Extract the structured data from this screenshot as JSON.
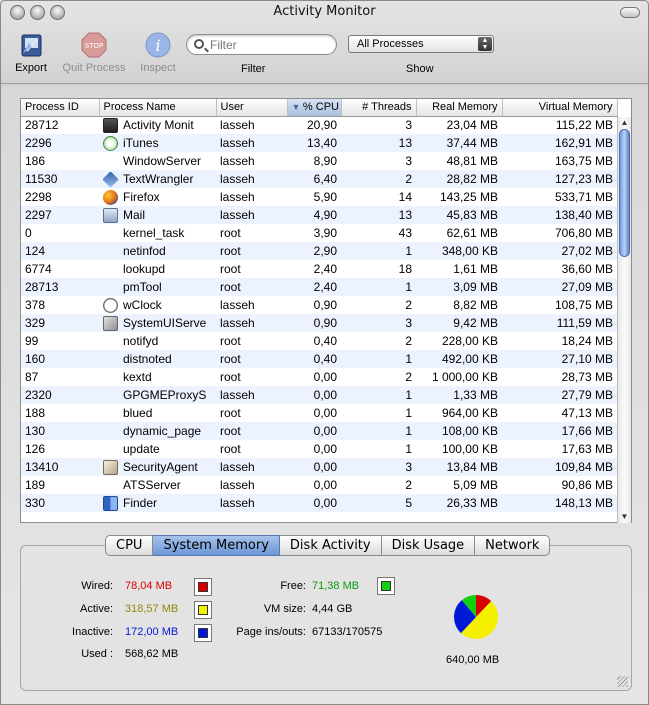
{
  "window": {
    "title": "Activity Monitor"
  },
  "toolbar": {
    "export_label": "Export",
    "quit_label": "Quit Process",
    "inspect_label": "Inspect",
    "filter_placeholder": "Filter",
    "filter_label": "Filter",
    "show_label": "Show",
    "show_value": "All Processes"
  },
  "table": {
    "columns": [
      "Process ID",
      "Process Name",
      "User",
      "% CPU",
      "# Threads",
      "Real Memory",
      "Virtual Memory"
    ],
    "sorted_column": "% CPU",
    "rows": [
      {
        "pid": "28712",
        "icon": "am",
        "name": "Activity Monit",
        "user": "lasseh",
        "cpu": "20,90",
        "threads": "3",
        "real": "23,04 MB",
        "virtual": "115,22 MB"
      },
      {
        "pid": "2296",
        "icon": "itunes",
        "name": "iTunes",
        "user": "lasseh",
        "cpu": "13,40",
        "threads": "13",
        "real": "37,44 MB",
        "virtual": "162,91 MB"
      },
      {
        "pid": "186",
        "icon": "blank",
        "name": "WindowServer",
        "user": "lasseh",
        "cpu": "8,90",
        "threads": "3",
        "real": "48,81 MB",
        "virtual": "163,75 MB"
      },
      {
        "pid": "11530",
        "icon": "tw",
        "name": "TextWrangler",
        "user": "lasseh",
        "cpu": "6,40",
        "threads": "2",
        "real": "28,82 MB",
        "virtual": "127,23 MB"
      },
      {
        "pid": "2298",
        "icon": "ff",
        "name": "Firefox",
        "user": "lasseh",
        "cpu": "5,90",
        "threads": "14",
        "real": "143,25 MB",
        "virtual": "533,71 MB"
      },
      {
        "pid": "2297",
        "icon": "mail",
        "name": "Mail",
        "user": "lasseh",
        "cpu": "4,90",
        "threads": "13",
        "real": "45,83 MB",
        "virtual": "138,40 MB"
      },
      {
        "pid": "0",
        "icon": "blank",
        "name": "kernel_task",
        "user": "root",
        "cpu": "3,90",
        "threads": "43",
        "real": "62,61 MB",
        "virtual": "706,80 MB"
      },
      {
        "pid": "124",
        "icon": "blank",
        "name": "netinfod",
        "user": "root",
        "cpu": "2,90",
        "threads": "1",
        "real": "348,00 KB",
        "virtual": "27,02 MB"
      },
      {
        "pid": "6774",
        "icon": "blank",
        "name": "lookupd",
        "user": "root",
        "cpu": "2,40",
        "threads": "18",
        "real": "1,61 MB",
        "virtual": "36,60 MB"
      },
      {
        "pid": "28713",
        "icon": "blank",
        "name": "pmTool",
        "user": "root",
        "cpu": "2,40",
        "threads": "1",
        "real": "3,09 MB",
        "virtual": "27,09 MB"
      },
      {
        "pid": "378",
        "icon": "clock",
        "name": "wClock",
        "user": "lasseh",
        "cpu": "0,90",
        "threads": "2",
        "real": "8,82 MB",
        "virtual": "108,75 MB"
      },
      {
        "pid": "329",
        "icon": "sysui",
        "name": "SystemUIServe",
        "user": "lasseh",
        "cpu": "0,90",
        "threads": "3",
        "real": "9,42 MB",
        "virtual": "111,59 MB"
      },
      {
        "pid": "99",
        "icon": "blank",
        "name": "notifyd",
        "user": "root",
        "cpu": "0,40",
        "threads": "2",
        "real": "228,00 KB",
        "virtual": "18,24 MB"
      },
      {
        "pid": "160",
        "icon": "blank",
        "name": "distnoted",
        "user": "root",
        "cpu": "0,40",
        "threads": "1",
        "real": "492,00 KB",
        "virtual": "27,10 MB"
      },
      {
        "pid": "87",
        "icon": "blank",
        "name": "kextd",
        "user": "root",
        "cpu": "0,00",
        "threads": "2",
        "real": "1 000,00 KB",
        "virtual": "28,73 MB"
      },
      {
        "pid": "2320",
        "icon": "blank",
        "name": "GPGMEProxyS",
        "user": "lasseh",
        "cpu": "0,00",
        "threads": "1",
        "real": "1,33 MB",
        "virtual": "27,79 MB"
      },
      {
        "pid": "188",
        "icon": "blank",
        "name": "blued",
        "user": "root",
        "cpu": "0,00",
        "threads": "1",
        "real": "964,00 KB",
        "virtual": "47,13 MB"
      },
      {
        "pid": "130",
        "icon": "blank",
        "name": "dynamic_page",
        "user": "root",
        "cpu": "0,00",
        "threads": "1",
        "real": "108,00 KB",
        "virtual": "17,66 MB"
      },
      {
        "pid": "126",
        "icon": "blank",
        "name": "update",
        "user": "root",
        "cpu": "0,00",
        "threads": "1",
        "real": "100,00 KB",
        "virtual": "17,63 MB"
      },
      {
        "pid": "13410",
        "icon": "sec",
        "name": "SecurityAgent",
        "user": "lasseh",
        "cpu": "0,00",
        "threads": "3",
        "real": "13,84 MB",
        "virtual": "109,84 MB"
      },
      {
        "pid": "189",
        "icon": "blank",
        "name": "ATSServer",
        "user": "lasseh",
        "cpu": "0,00",
        "threads": "2",
        "real": "5,09 MB",
        "virtual": "90,86 MB"
      },
      {
        "pid": "330",
        "icon": "finder",
        "name": "Finder",
        "user": "lasseh",
        "cpu": "0,00",
        "threads": "5",
        "real": "26,33 MB",
        "virtual": "148,13 MB"
      }
    ]
  },
  "tabs": [
    "CPU",
    "System Memory",
    "Disk Activity",
    "Disk Usage",
    "Network"
  ],
  "selected_tab": "System Memory",
  "memory": {
    "wired_label": "Wired:",
    "wired_value": "78,04 MB",
    "wired_color": "#d80000",
    "active_label": "Active:",
    "active_value": "318,57 MB",
    "active_color": "#f5f000",
    "inactive_label": "Inactive:",
    "inactive_value": "172,00 MB",
    "inactive_color": "#0018d8",
    "used_label": "Used :",
    "used_value": "568,62 MB",
    "free_label": "Free:",
    "free_value": "71,38 MB",
    "free_color": "#10d010",
    "vm_label": "VM size:",
    "vm_value": "4,44 GB",
    "pageins_label": "Page ins/outs:",
    "pageins_value": "67133/170575",
    "total": "640,00 MB",
    "wired_mb": 78.04,
    "active_mb": 318.57,
    "inactive_mb": 172.0,
    "free_mb": 71.38
  }
}
